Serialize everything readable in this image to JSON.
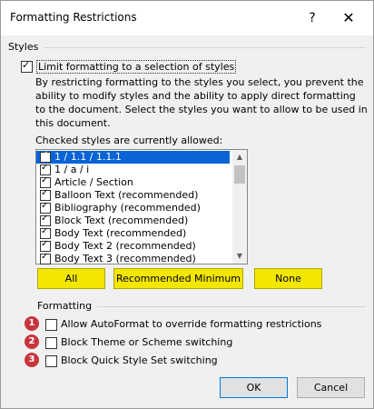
{
  "window": {
    "title": "Formatting Restrictions"
  },
  "titlebar": {
    "help_label": "?",
    "close_label": "✕"
  },
  "styles_group": {
    "label": "Styles",
    "limit_checkbox": {
      "label": "Limit formatting to a selection of styles",
      "checked": true
    },
    "description": "By restricting formatting to the styles you select, you prevent the ability to modify styles and the ability to apply direct formatting to the document. Select the styles you want to allow to be used in this document.",
    "list_label": "Checked styles are currently allowed:",
    "styles": [
      {
        "label": "1 / 1.1 / 1.1.1",
        "checked": true,
        "selected": true
      },
      {
        "label": "1 / a / i",
        "checked": true
      },
      {
        "label": "Article / Section",
        "checked": true
      },
      {
        "label": "Balloon Text (recommended)",
        "checked": true
      },
      {
        "label": "Bibliography (recommended)",
        "checked": true
      },
      {
        "label": "Block Text (recommended)",
        "checked": true
      },
      {
        "label": "Body Text (recommended)",
        "checked": true
      },
      {
        "label": "Body Text 2 (recommended)",
        "checked": true
      },
      {
        "label": "Body Text 3 (recommended)",
        "checked": true
      }
    ],
    "buttons": {
      "all": "All",
      "recommended": "Recommended Minimum",
      "none": "None"
    }
  },
  "formatting_group": {
    "label": "Formatting",
    "options": [
      {
        "badge": "1",
        "label": "Allow AutoFormat to override formatting restrictions",
        "checked": false
      },
      {
        "badge": "2",
        "label": "Block Theme or Scheme switching",
        "checked": false
      },
      {
        "badge": "3",
        "label": "Block Quick Style Set switching",
        "checked": false
      }
    ]
  },
  "footer": {
    "ok_label": "OK",
    "cancel_label": "Cancel"
  },
  "colors": {
    "highlight": "#f3e600",
    "badge": "#c8353d",
    "selection": "#0a64d6"
  }
}
